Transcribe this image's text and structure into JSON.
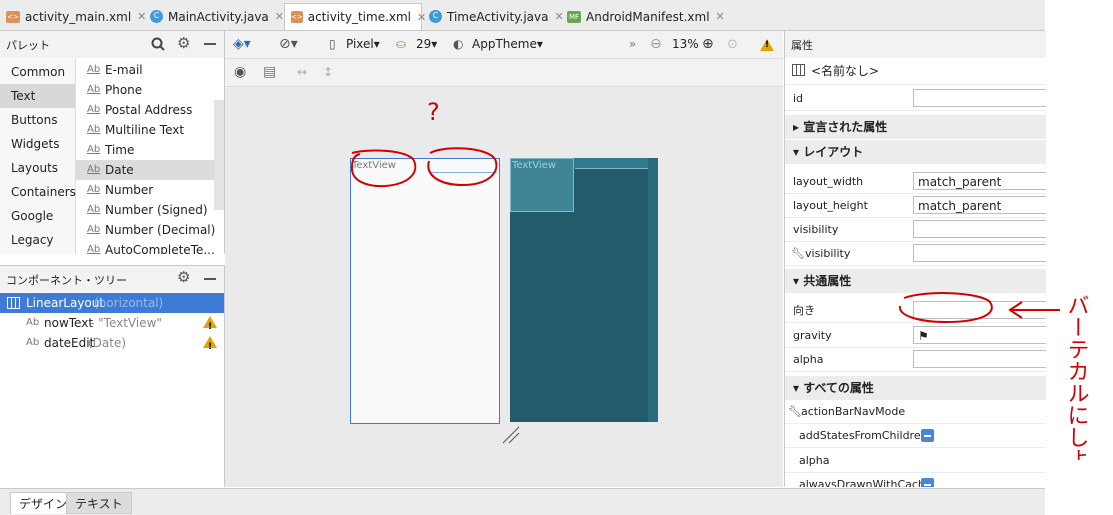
{
  "tabs": [
    {
      "label": "activity_main.xml",
      "icon": "xml-file-icon",
      "active": false
    },
    {
      "label": "MainActivity.java",
      "icon": "java-class-icon",
      "active": false
    },
    {
      "label": "activity_time.xml",
      "icon": "xml-file-icon",
      "active": true
    },
    {
      "label": "TimeActivity.java",
      "icon": "java-class-icon",
      "active": false
    },
    {
      "label": "AndroidManifest.xml",
      "icon": "manifest-file-icon",
      "active": false
    }
  ],
  "palette": {
    "title": "パレット",
    "categories": [
      "Common",
      "Text",
      "Buttons",
      "Widgets",
      "Layouts",
      "Containers",
      "Google",
      "Legacy"
    ],
    "selected_category": "Text",
    "items": [
      "E-mail",
      "Phone",
      "Postal Address",
      "Multiline Text",
      "Time",
      "Date",
      "Number",
      "Number (Signed)",
      "Number (Decimal)",
      "AutoCompleteTe..."
    ],
    "selected_item": "Date",
    "ab_glyph": "Ab"
  },
  "tree": {
    "title": "コンポーネント・ツリー",
    "root": {
      "name": "LinearLayout",
      "detail": "(horizontal)"
    },
    "children": [
      {
        "name": "nowText",
        "detail": "- \"TextView\"",
        "warning": true
      },
      {
        "name": "dateEdit",
        "detail": "(Date)",
        "warning": true
      }
    ]
  },
  "toolbar": {
    "device": "Pixel",
    "api": "29",
    "theme": "AppTheme",
    "zoom": "13%"
  },
  "canvas": {
    "design_textview": "TextView",
    "blueprint_textview": "TextView",
    "annotation_mark": "?"
  },
  "attributes": {
    "title": "属性",
    "component": "<名前なし>",
    "id_label": "id",
    "id_value": "",
    "sections": {
      "declared": "宣言された属性",
      "layout": "レイアウト",
      "common": "共通属性",
      "all": "すべての属性"
    },
    "layout_width_label": "layout_width",
    "layout_width_value": "match_parent",
    "layout_height_label": "layout_height",
    "layout_height_value": "match_parent",
    "visibility_label": "visibility",
    "tools_visibility_label": "visibility",
    "orientation_label": "向き",
    "gravity_label": "gravity",
    "alpha_label": "alpha",
    "all_rows": [
      "actionBarNavMode",
      "addStatesFromChildren",
      "alpha",
      "alwaysDrawnWithCache"
    ]
  },
  "annotation": {
    "text": "バーテカルにしよう"
  },
  "bottom_tabs": {
    "design": "デザイン",
    "text": "テキスト"
  },
  "colors": {
    "selection": "#3d7bd6",
    "blueprint": "#245b6b",
    "warning": "#e2a500",
    "annotation": "#d40000"
  }
}
